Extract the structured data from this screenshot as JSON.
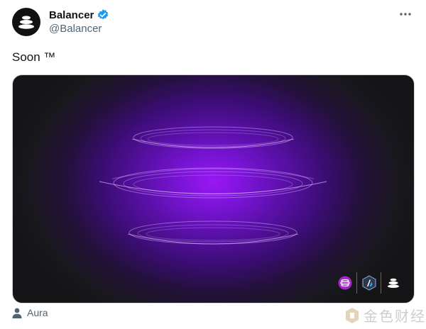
{
  "author": {
    "display_name": "Balancer",
    "handle": "@Balancer",
    "verified": true,
    "avatar_icon": "balancer-logo-icon"
  },
  "menu": {
    "icon": "more-horizontal-icon"
  },
  "tweet": {
    "text": "Soon ™"
  },
  "media": {
    "partner_logos": [
      "aura-logo-icon",
      "arbitrum-logo-icon",
      "balancer-logo-icon"
    ],
    "colors": {
      "accent": "#9a17f4",
      "background": "#18181c"
    }
  },
  "attribution": {
    "icon": "person-icon",
    "label": "Aura"
  },
  "watermark": {
    "text": "金色财经"
  },
  "colors": {
    "verified_blue": "#1d9bf0",
    "secondary_text": "#536471"
  }
}
